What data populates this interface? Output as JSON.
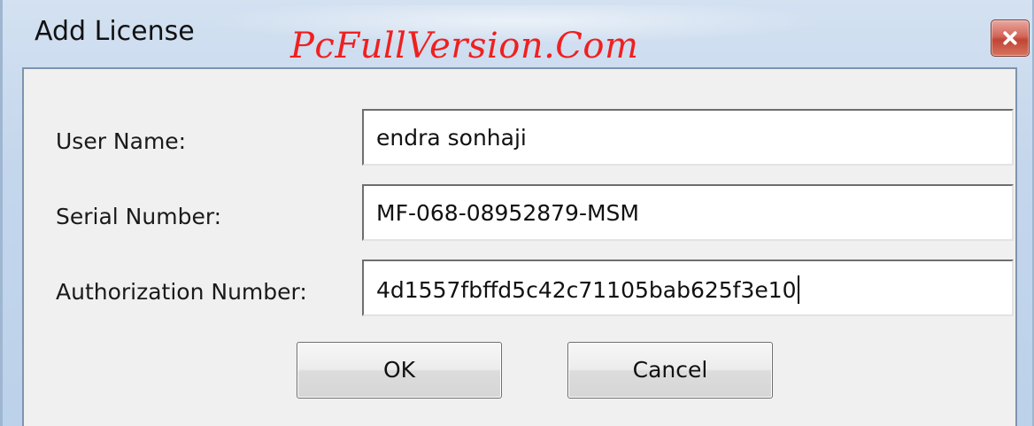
{
  "window": {
    "title": "Add License",
    "watermark": "PcFullVersion.Com"
  },
  "form": {
    "user_name": {
      "label": "User Name:",
      "value": "endra sonhaji"
    },
    "serial_number": {
      "label": "Serial Number:",
      "value": "MF-068-08952879-MSM"
    },
    "authorization_number": {
      "label": "Authorization Number:",
      "value": "4d1557fbffd5c42c71105bab625f3e10"
    }
  },
  "buttons": {
    "ok_label": "OK",
    "cancel_label": "Cancel"
  },
  "icons": {
    "close": "close-icon"
  },
  "colors": {
    "watermark": "#ef2020",
    "close_button": "#c04534",
    "dialog_background": "#f0f0f0",
    "titlebar": "#c4d6ec"
  }
}
